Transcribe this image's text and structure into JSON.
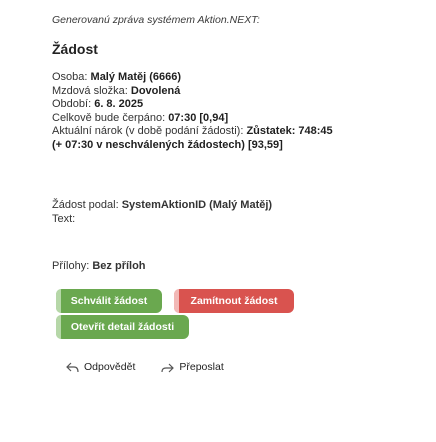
{
  "header": {
    "generated_note": "Generovanú zpráva systémem Aktion.NEXT:",
    "title": "Žádost"
  },
  "details": {
    "person_label": "Osoba: ",
    "person_value": "Malý Matěj (6666)",
    "wage_label": "Mzdová složka: ",
    "wage_value": "Dovolená",
    "period_label": "Období: ",
    "period_value": "6. 8. 2025",
    "total_label": "Celkově bude čerpáno: ",
    "total_value": "07:30 [0,94]",
    "claim_label": "Aktuální nárok (v době podání žádosti): ",
    "claim_value": "Zůstatek: 748:45",
    "claim_extra": "(+ 07:30 v neschválených žádostech) [93,59]"
  },
  "request": {
    "submitted_label": "Žádost podal: ",
    "submitted_value": "SystemAktionID (Malý Matěj)",
    "text_label": "Text:"
  },
  "attachments": {
    "label": "Přílohy: ",
    "value": "Bez příloh"
  },
  "buttons": {
    "approve": "Schválit žádost",
    "reject": "Zamítnout žádost",
    "detail": "Otevřít detail žádosti"
  },
  "actions": {
    "reply": "Odpovědět",
    "forward": "Přeposlat"
  },
  "colors": {
    "approve": "#6aa84f",
    "reject": "#d9534f"
  }
}
